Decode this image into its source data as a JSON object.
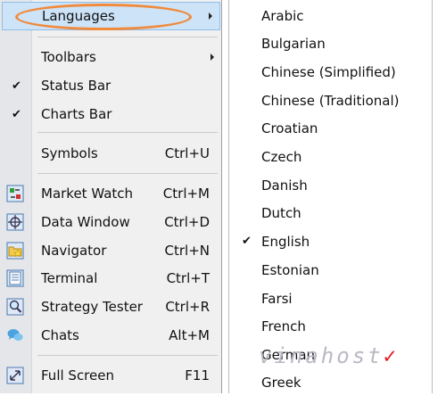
{
  "menu": {
    "languages": "Languages",
    "toolbars": "Toolbars",
    "status_bar": "Status Bar",
    "charts_bar": "Charts Bar",
    "symbols": "Symbols",
    "symbols_shortcut": "Ctrl+U",
    "market_watch": "Market Watch",
    "market_watch_shortcut": "Ctrl+M",
    "data_window": "Data Window",
    "data_window_shortcut": "Ctrl+D",
    "navigator": "Navigator",
    "navigator_shortcut": "Ctrl+N",
    "terminal": "Terminal",
    "terminal_shortcut": "Ctrl+T",
    "strategy_tester": "Strategy Tester",
    "strategy_tester_shortcut": "Ctrl+R",
    "chats": "Chats",
    "chats_shortcut": "Alt+M",
    "full_screen": "Full Screen",
    "full_screen_shortcut": "F11",
    "check_mark": "✔"
  },
  "languages": {
    "items": [
      "Arabic",
      "Bulgarian",
      "Chinese (Simplified)",
      "Chinese (Traditional)",
      "Croatian",
      "Czech",
      "Danish",
      "Dutch",
      "English",
      "Estonian",
      "Farsi",
      "French",
      "German",
      "Greek"
    ],
    "selected": "English"
  },
  "watermark": {
    "text": "vinahost",
    "mark": "✓"
  },
  "colors": {
    "highlight": "#cde3f7",
    "highlight_border": "#8fbde8",
    "annotation_oval": "#f08a3c",
    "watermark_mark": "#e01f26"
  },
  "icons": {
    "market_watch": "market-watch-icon",
    "data_window": "crosshair-icon",
    "navigator": "folder-star-icon",
    "terminal": "terminal-icon",
    "strategy_tester": "magnifier-icon",
    "chats": "chat-bubbles-icon",
    "full_screen": "fullscreen-icon"
  }
}
